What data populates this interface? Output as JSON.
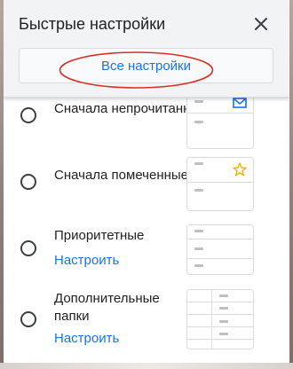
{
  "header": {
    "title": "Быстрые настройки",
    "all_settings_label": "Все настройки",
    "close_icon": "close-icon"
  },
  "inbox_types": [
    {
      "label": "Сначала непрочитанные",
      "thumb_icon": "envelope-icon",
      "selected": false
    },
    {
      "label": "Сначала помеченные",
      "thumb_icon": "star-icon",
      "selected": false
    },
    {
      "label": "Приоритетные",
      "action": "Настроить",
      "selected": false
    },
    {
      "label": "Дополнительные папки",
      "action": "Настроить",
      "selected": false
    }
  ],
  "colors": {
    "accent": "#1a73e8",
    "annotation_oval": "#d93025",
    "star": "#f4b400"
  }
}
